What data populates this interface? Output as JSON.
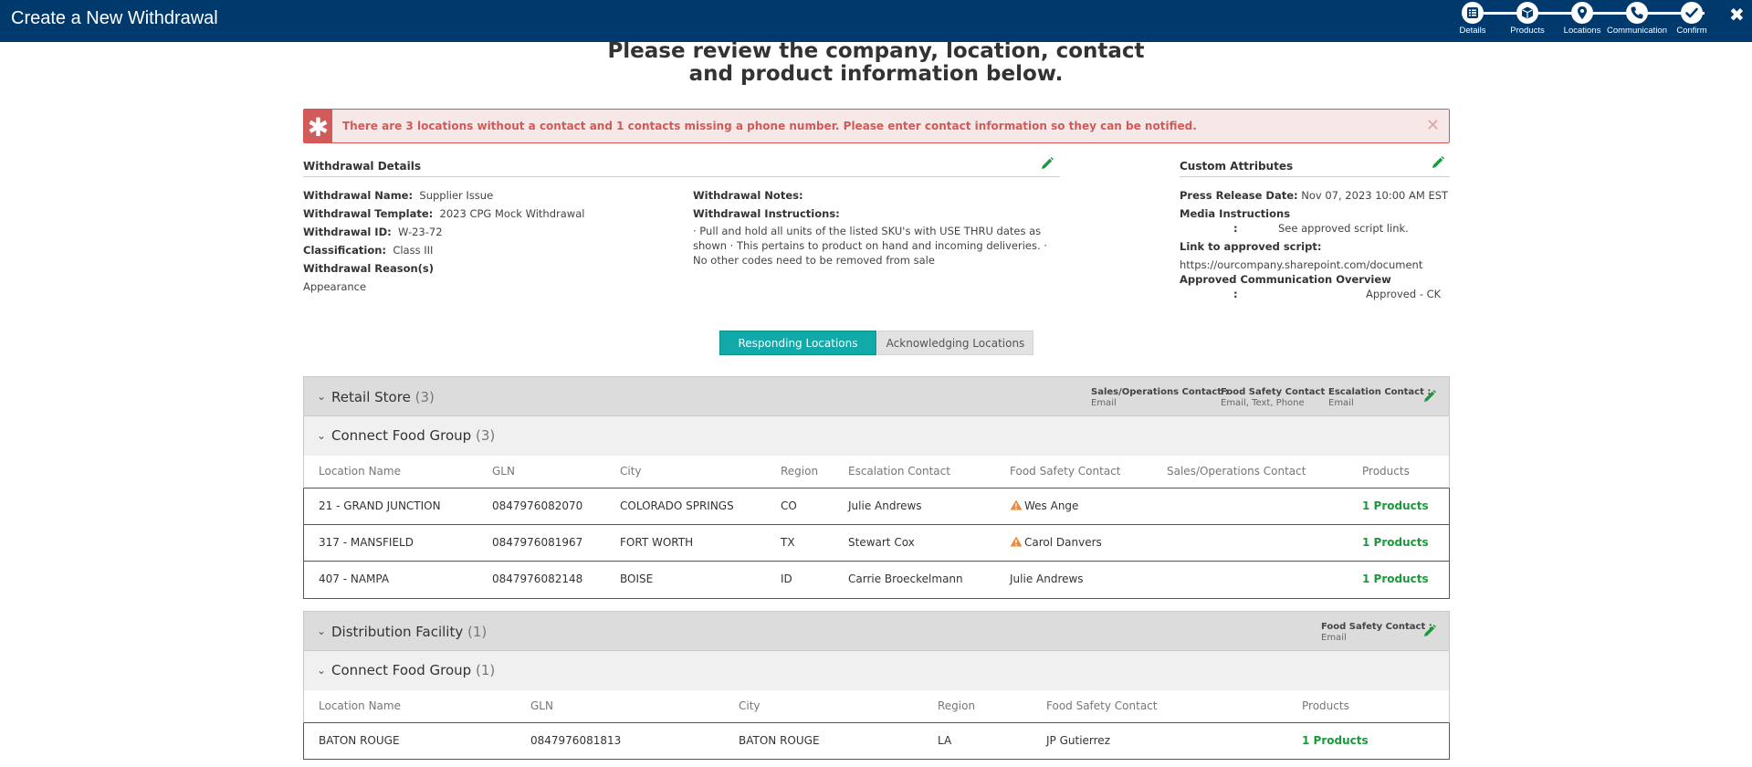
{
  "header": {
    "title": "Create a New Withdrawal",
    "steps": [
      {
        "label": "Details",
        "icon": "list-icon"
      },
      {
        "label": "Products",
        "icon": "box-icon"
      },
      {
        "label": "Locations",
        "icon": "location-pin-icon"
      },
      {
        "label": "Communication",
        "icon": "phone-icon"
      },
      {
        "label": "Confirm",
        "icon": "check-icon"
      }
    ],
    "close_icon": "close-icon"
  },
  "heading": {
    "line1": "Please review the company, location, contact",
    "line2": "and product information below."
  },
  "alert": {
    "icon": "asterisk-icon",
    "text": "There are 3 locations without a contact and 1 contacts missing a phone number. Please enter contact information so they can be notified.",
    "close": "✕"
  },
  "withdrawal_details": {
    "title": "Withdrawal Details",
    "name_label": "Withdrawal Name:",
    "name_value": "Supplier Issue",
    "template_label": "Withdrawal Template:",
    "template_value": "2023 CPG Mock Withdrawal",
    "id_label": "Withdrawal ID:",
    "id_value": "W-23-72",
    "classification_label": "Classification:",
    "classification_value": "Class III",
    "reasons_label": "Withdrawal Reason(s)",
    "reasons_value": "Appearance",
    "notes_label": "Withdrawal Notes:",
    "instructions_label": "Withdrawal Instructions:",
    "instructions_value": "· Pull and hold all units of the listed SKU's with USE THRU dates as shown · This pertains to product on hand and incoming deliveries. · No other codes need to be removed from sale"
  },
  "custom_attributes": {
    "title": "Custom Attributes",
    "press_label": "Press Release Date:",
    "press_value": "Nov 07, 2023 10:00 AM EST",
    "media_label": "Media Instructions",
    "media_colon": ":",
    "media_value": "See approved script link.",
    "script_label": "Link to approved script:",
    "script_value": "https://ourcompany.sharepoint.com/document",
    "overview_label": "Approved Communication Overview",
    "overview_colon": ":",
    "overview_value": "Approved - CK"
  },
  "tabs": {
    "responding": "Responding Locations",
    "acknowledging": "Acknowledging Locations",
    "active": "responding"
  },
  "groups": [
    {
      "title": "Retail Store",
      "count": "(3)",
      "contacts": [
        {
          "label": "Sales/Operations Contact :",
          "value": "Email"
        },
        {
          "label": "Food Safety Contact :",
          "value": "Email, Text, Phone"
        },
        {
          "label": "Escalation Contact :",
          "value": "Email"
        }
      ],
      "subgroup": {
        "title": "Connect Food Group",
        "count": "(3)"
      },
      "columns": [
        "Location Name",
        "GLN",
        "City",
        "Region",
        "Escalation Contact",
        "Food Safety Contact",
        "Sales/Operations Contact",
        "Products"
      ],
      "rows": [
        {
          "name": "21 - GRAND JUNCTION",
          "gln": "0847976082070",
          "city": "COLORADO SPRINGS",
          "region": "CO",
          "escalation": "Julie Andrews",
          "food_safety": "Wes Ange",
          "food_safety_warning": true,
          "sales": "",
          "products": "1 Products"
        },
        {
          "name": "317 - MANSFIELD",
          "gln": "0847976081967",
          "city": "FORT WORTH",
          "region": "TX",
          "escalation": "Stewart Cox",
          "food_safety": "Carol Danvers",
          "food_safety_warning": true,
          "sales": "",
          "products": "1 Products"
        },
        {
          "name": "407 - NAMPA",
          "gln": "0847976082148",
          "city": "BOISE",
          "region": "ID",
          "escalation": "Carrie Broeckelmann",
          "food_safety": "Julie Andrews",
          "food_safety_warning": false,
          "sales": "",
          "products": "1 Products"
        }
      ]
    },
    {
      "title": "Distribution Facility",
      "count": "(1)",
      "contacts": [
        {
          "label": "Food Safety Contact :",
          "value": "Email"
        }
      ],
      "subgroup": {
        "title": "Connect Food Group",
        "count": "(1)"
      },
      "columns": [
        "Location Name",
        "GLN",
        "City",
        "Region",
        "Food Safety Contact",
        "Products"
      ],
      "rows": [
        {
          "name": "BATON ROUGE",
          "gln": "0847976081813",
          "city": "BATON ROUGE",
          "region": "LA",
          "food_safety": "JP Gutierrez",
          "products": "1 Products"
        }
      ]
    }
  ],
  "colors": {
    "header_bg": "#003a6c",
    "accent_teal": "#12aaa9",
    "link_green": "#1a9a3a",
    "alert_red": "#d15b5b",
    "warning_orange": "#f0883a"
  }
}
